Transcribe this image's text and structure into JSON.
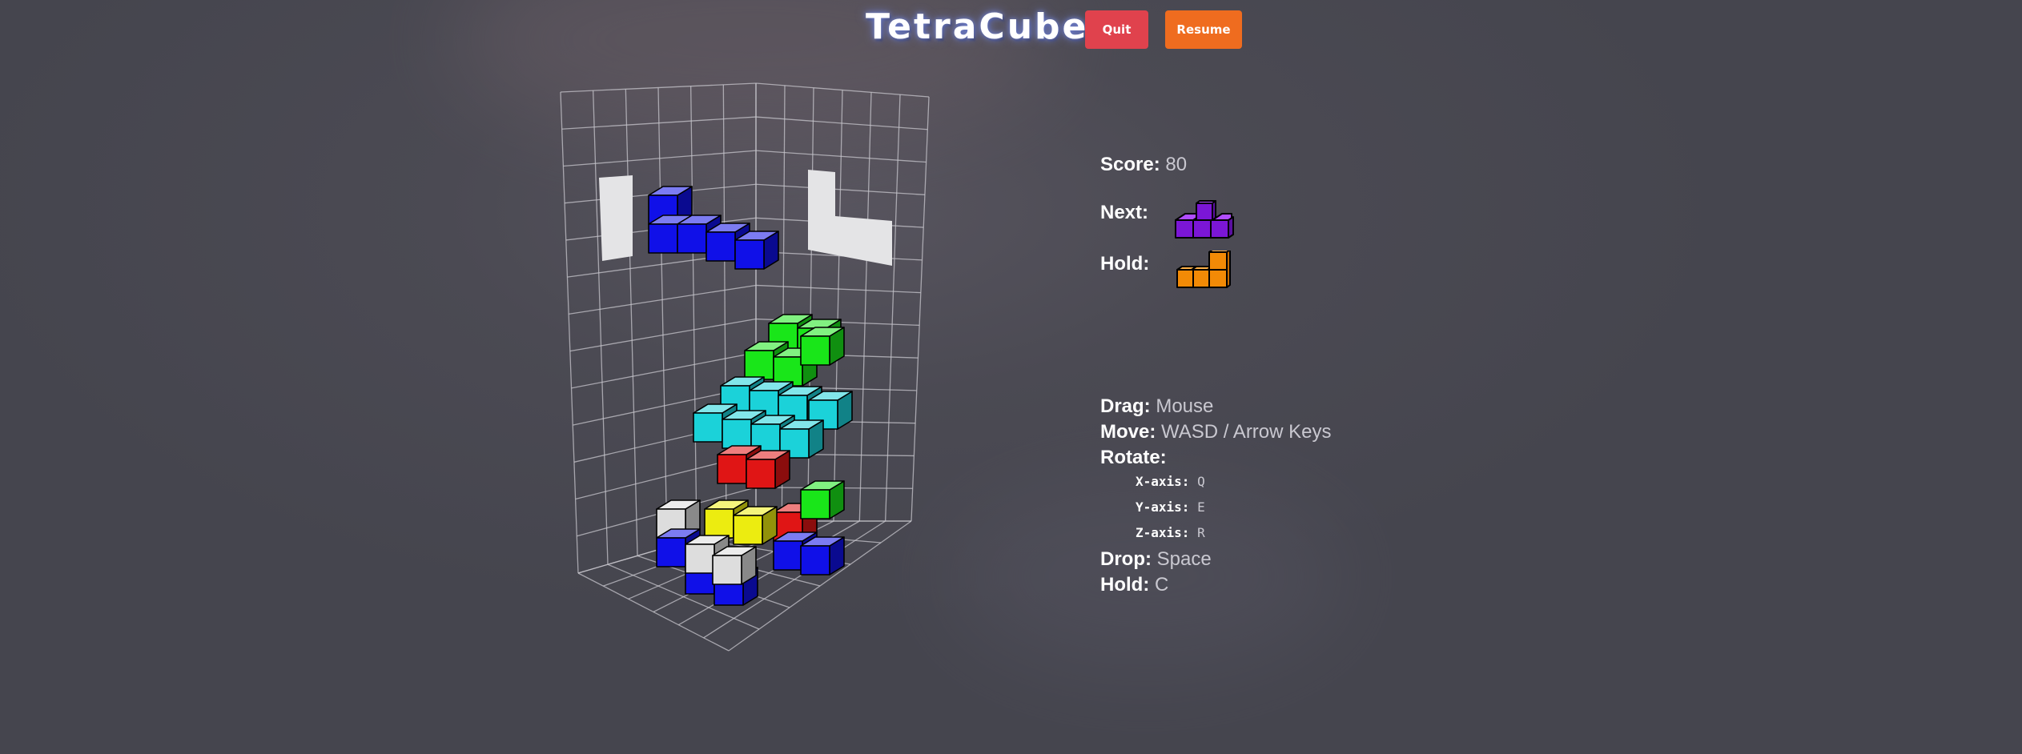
{
  "header": {
    "title": "TetraCube",
    "quit_label": "Quit",
    "resume_label": "Resume"
  },
  "info": {
    "score_label": "Score:",
    "score_value": "80",
    "next_label": "Next:",
    "next_piece": "purple-t-piece",
    "hold_label": "Hold:",
    "hold_piece": "orange-l-piece"
  },
  "controls": {
    "drag_label": "Drag:",
    "drag_value": "Mouse",
    "move_label": "Move:",
    "move_value": "WASD / Arrow Keys",
    "rotate_label": "Rotate:",
    "x_axis_label": "X-axis:",
    "x_axis_value": "Q",
    "y_axis_label": "Y-axis:",
    "y_axis_value": "E",
    "z_axis_label": "Z-axis:",
    "z_axis_value": "R",
    "drop_label": "Drop:",
    "drop_value": "Space",
    "hold_label": "Hold:",
    "hold_value": "C"
  },
  "colors": {
    "blue": "#1010e8",
    "green": "#19e619",
    "cyan": "#1bd2d9",
    "red": "#e01515",
    "yellow": "#ecec10",
    "white": "#dddddd",
    "purple": "#7b16d6",
    "orange": "#f28a06",
    "quit": "#e0424d",
    "resume": "#ef6c1f"
  }
}
